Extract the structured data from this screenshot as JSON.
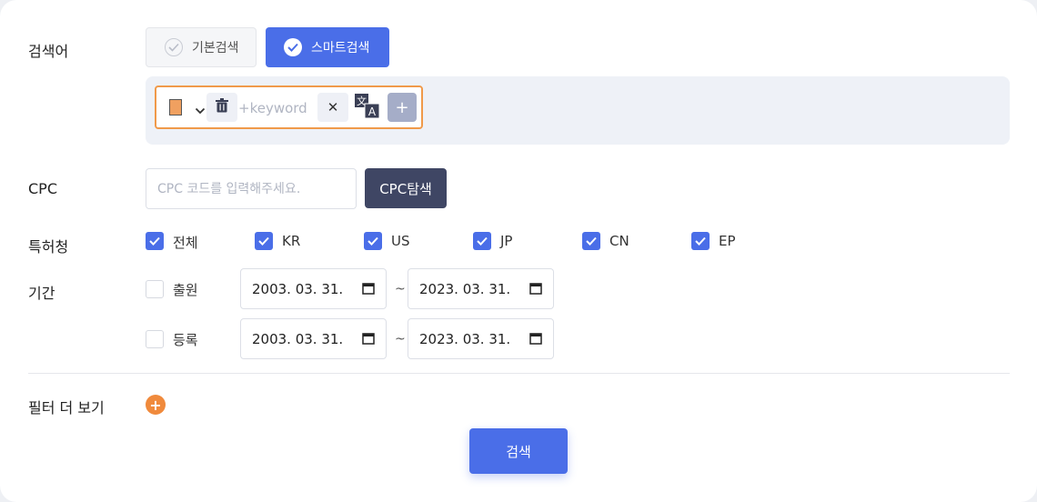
{
  "labels": {
    "keyword": "검색어",
    "cpc": "CPC",
    "office": "특허청",
    "period": "기간",
    "more_filters": "필터 더 보기"
  },
  "mode": {
    "basic_label": "기본검색",
    "smart_label": "스마트검색",
    "selected": "스마트검색"
  },
  "keyword_box": {
    "placeholder": "+keyword",
    "value": "",
    "color": "#f0a060",
    "add_symbol": "+",
    "clear_symbol": "✕"
  },
  "cpc": {
    "placeholder": "CPC 코드를 입력해주세요.",
    "value": "",
    "button_label": "CPC탐색"
  },
  "offices": [
    {
      "label": "전체",
      "checked": true
    },
    {
      "label": "KR",
      "checked": true
    },
    {
      "label": "US",
      "checked": true
    },
    {
      "label": "JP",
      "checked": true
    },
    {
      "label": "CN",
      "checked": true
    },
    {
      "label": "EP",
      "checked": true
    }
  ],
  "periods": [
    {
      "label": "출원",
      "checked": false,
      "from": "2003. 03. 31.",
      "to": "2023. 03. 31."
    },
    {
      "label": "등록",
      "checked": false,
      "from": "2003. 03. 31.",
      "to": "2023. 03. 31."
    }
  ],
  "range_separator": "~",
  "more_filters_symbol": "+",
  "search_button": "검색",
  "colors": {
    "accent": "#4a6ee8",
    "dark_button": "#3f4664",
    "orange": "#f08a3c",
    "keyword_border": "#f09a4a"
  }
}
